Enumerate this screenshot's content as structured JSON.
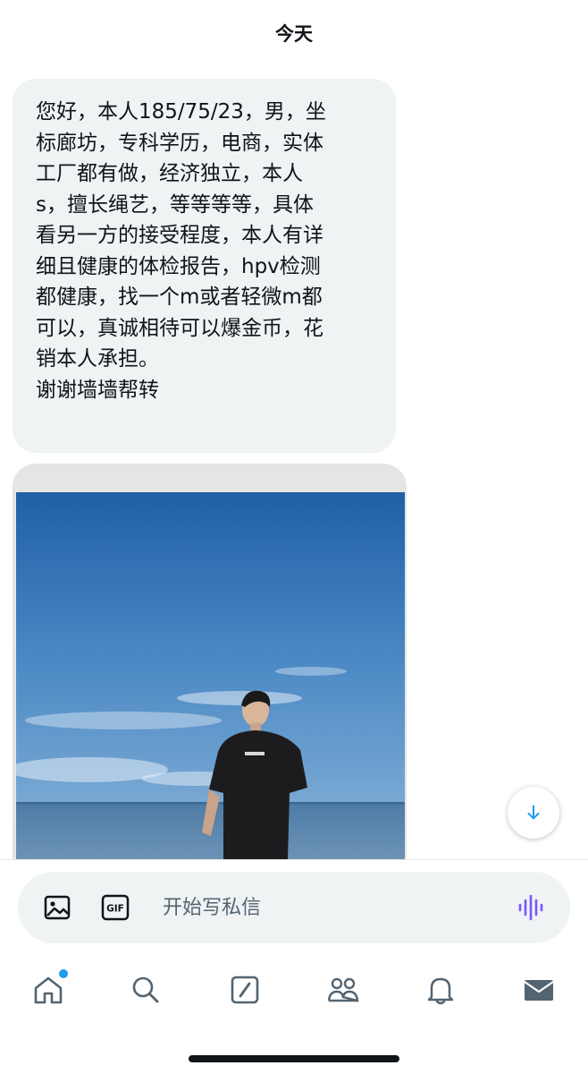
{
  "header": {
    "date_label": "今天"
  },
  "message": {
    "text": "您好，本人185/75/23，男，坐\n标廊坊，专科学历，电商，实体\n工厂都有做，经济独立，本人\ns，擅长绳艺，等等等等，具体\n看另一方的接受程度，本人有详\n细且健康的体检报告，hpv检测\n都健康，找一个m或者轻微m都\n可以，真诚相待可以爆金币，花\n销本人承担。\n谢谢墙墙帮转"
  },
  "composer": {
    "placeholder": "开始写私信"
  },
  "tabbar": {
    "items": [
      "home-icon",
      "search-icon",
      "compose-icon",
      "communities-icon",
      "notifications-icon",
      "messages-icon"
    ],
    "home_has_new": true
  },
  "colors": {
    "accent": "#1d9bf0",
    "voice": "#7856ff",
    "bubble": "#eff3f4",
    "text": "#0f1419"
  }
}
